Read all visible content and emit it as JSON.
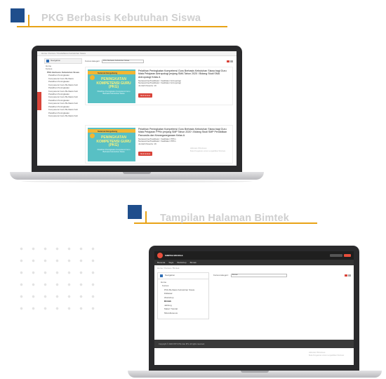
{
  "sections": [
    {
      "title": "PKG Berbasis Kebutuhan Siswa"
    },
    {
      "title": "Tampilan Halaman Bimtek"
    }
  ],
  "colors": {
    "brand_blue": "#1f4e8c",
    "accent_orange": "#e8a317",
    "heading_grey": "#cfcfcf",
    "danger_red": "#d9443a"
  },
  "screen1": {
    "breadcrumb": "Home / Kursus / Pendaftaran Kebutuhan Siswa",
    "navigation_label": "Navigation",
    "filter_label": "Kursus kategori",
    "filter_value": "PKG Berbasis Kebutuhan Siswa",
    "side_tab": "Navigasi",
    "tree": [
      "Home",
      "Kursus",
      "PKG Berbasis Kebutuhan Siswa",
      "Pelatihan Peningkatan",
      "Kompetensi Guru Berbasis",
      "Pelatihan Peningkatan",
      "Kompetensi Guru Berbasis Keb",
      "Pelatihan Peningkatan",
      "Kompetensi Guru Berbasis Keb",
      "Pelatihan Peningkatan",
      "Kompetensi Guru Berbasis Keb",
      "Pelatihan Peningkatan",
      "Kompetensi Guru Berbasis Keb",
      "Pelatihan Peningkatan",
      "Kompetensi Guru Berbasis Keb",
      "Pelatihan Peningkatan",
      "Kompetensi Guru Berbasis Keb"
    ],
    "cards": [
      {
        "thumb_top": "Selamat Bergabung",
        "thumb_title": "PENINGKATAN KOMPETENSI GURU (PKG)",
        "thumb_sub": "Pelatihan Peningkatan Kompetensi Guru Berbasis Kebutuhan Siswa",
        "title": "Pelatihan Peningkatan Kompetensi Guru Berbasis Kebutuhan Siswa bagi Guru Mata Pelajaran Antropologi jenjang SMA Tahun 2020 \\ Bidang Studi SMA Antropologi Kelas A",
        "meta1": "Narasumber/Fasilitator: Fasilitator Antropologi",
        "meta2": "Narasumber/Fasilitator: Fasilitator Antropologi",
        "meta3": "Jumlah Peserta: 16",
        "button": "Ikuti kursus"
      },
      {
        "thumb_top": "Selamat Bergabung",
        "thumb_title": "PENINGKATAN KOMPETENSI GURU (PKG)",
        "thumb_sub": "Pelatihan Peningkatan Kompetensi Guru Berbasis Kebutuhan Siswa",
        "title": "Pelatihan Peningkatan Kompetensi Guru Berbasis Kebutuhan Siswa bagi Guru Mata Pelajaran PPKn jenjang SMP Tahun 2020 \\ Bidang Studi SMP Pendidikan Pancasila dan Kewarganegaraan Kelas A",
        "meta1": "Narasumber/Fasilitator: Fasilitator PPKn",
        "meta2": "Narasumber/Fasilitator: Fasilitator PPKn",
        "meta3": "Jumlah Peserta: 16",
        "button": "Ikuti kursus"
      }
    ],
    "watermark1": "Aktivasi Windows",
    "watermark2": "Buka Pengaturan untuk mengaktifkan Windows"
  },
  "screen2": {
    "brand": "SIMPKB MOODLE",
    "nav": [
      "Beranda",
      "Saya",
      "Workshop",
      "Bimtek"
    ],
    "breadcrumb": "Home / Kursus / Bimtek",
    "navigation_label": "Navigation",
    "tree": [
      "Home",
      "Kursus",
      "PKG Berbasis Kebutuhan Siswa",
      "Diklatsar",
      "Workshop",
      "Bimtek",
      "Jabfung",
      "Materi Tutorial",
      "Miscellaneous"
    ],
    "filter_label": "Kursus kategori:",
    "filter_value": "Bimtek",
    "footer": "Copyright © 2020 P4TK PKn dan IPS. All rights reserved.",
    "watermark1": "Aktivasi Windows",
    "watermark2": "Buka Pengaturan untuk mengaktifkan Windows"
  }
}
